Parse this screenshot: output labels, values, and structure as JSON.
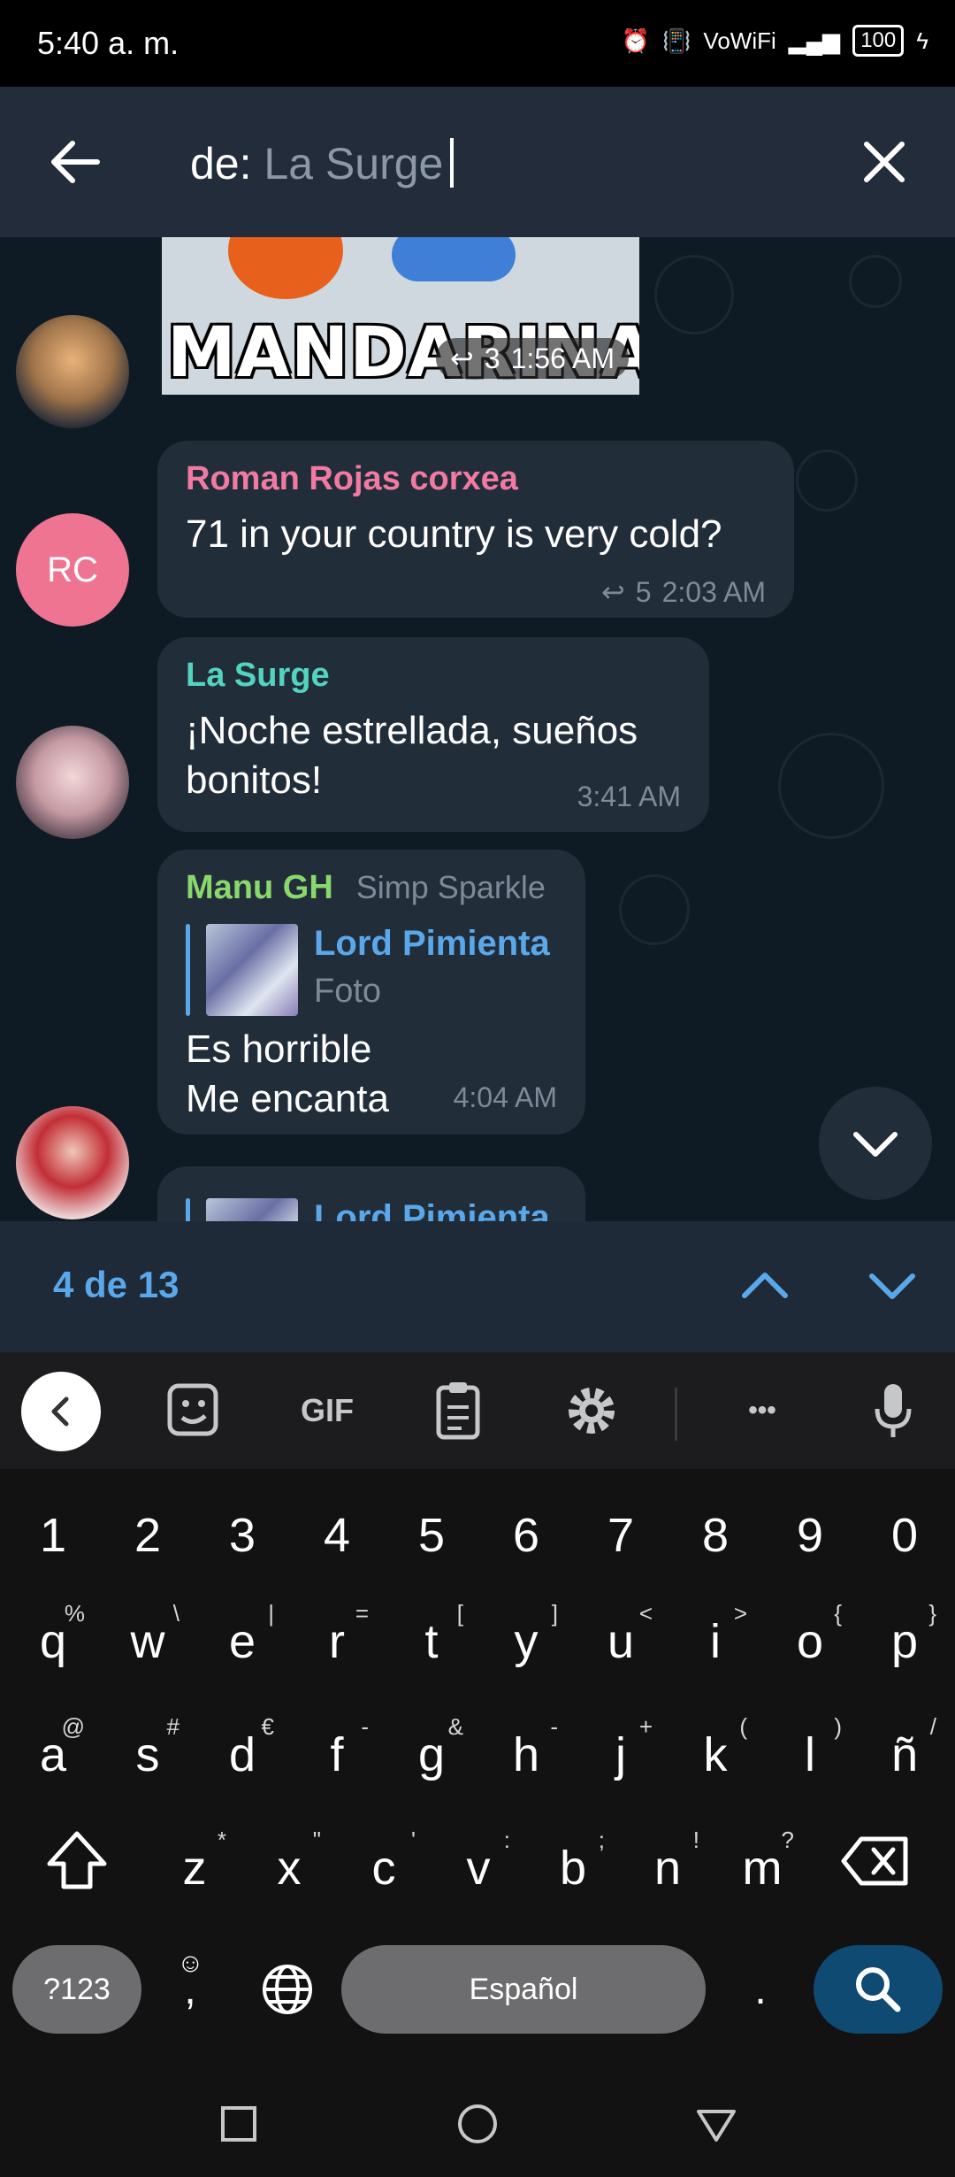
{
  "status_bar": {
    "time": "5:40 a. m.",
    "network_label": "VoWiFi",
    "battery": "100"
  },
  "search": {
    "prefix": "de:",
    "query": "La Surge"
  },
  "messages": [
    {
      "media_caption": "MANDARINA?",
      "replies": "3",
      "time": "1:56 AM"
    },
    {
      "avatar_initials": "RC",
      "sender": "Roman Rojas corxea",
      "text": "71 in your country is very cold?",
      "replies": "5",
      "time": "2:03 AM"
    },
    {
      "sender": "La Surge",
      "text_line1": "¡Noche estrellada, sueños",
      "text_line2": "bonitos!",
      "time": "3:41 AM"
    },
    {
      "sender": "Manu GH",
      "sender_title": "Simp Sparkle",
      "quote_name": "Lord Pimienta",
      "quote_type": "Foto",
      "text_line1": "Es horrible",
      "text_line2": "Me encanta",
      "time": "4:04 AM"
    },
    {
      "quote_name": "Lord Pimienta"
    }
  ],
  "results": {
    "count_label": "4 de 13"
  },
  "keyboard": {
    "toolbar": {
      "gif": "GIF",
      "more": "•••"
    },
    "numbers": [
      "1",
      "2",
      "3",
      "4",
      "5",
      "6",
      "7",
      "8",
      "9",
      "0"
    ],
    "row1": [
      {
        "k": "q",
        "h": "%"
      },
      {
        "k": "w",
        "h": "\\"
      },
      {
        "k": "e",
        "h": "|"
      },
      {
        "k": "r",
        "h": "="
      },
      {
        "k": "t",
        "h": "["
      },
      {
        "k": "y",
        "h": "]"
      },
      {
        "k": "u",
        "h": "<"
      },
      {
        "k": "i",
        "h": ">"
      },
      {
        "k": "o",
        "h": "{"
      },
      {
        "k": "p",
        "h": "}"
      }
    ],
    "row2": [
      {
        "k": "a",
        "h": "@"
      },
      {
        "k": "s",
        "h": "#"
      },
      {
        "k": "d",
        "h": "€"
      },
      {
        "k": "f",
        "h": "-"
      },
      {
        "k": "g",
        "h": "&"
      },
      {
        "k": "h",
        "h": "-"
      },
      {
        "k": "j",
        "h": "+"
      },
      {
        "k": "k",
        "h": "("
      },
      {
        "k": "l",
        "h": ")"
      },
      {
        "k": "ñ",
        "h": "/"
      }
    ],
    "row3": [
      {
        "k": "z",
        "h": "*"
      },
      {
        "k": "x",
        "h": "\""
      },
      {
        "k": "c",
        "h": "'"
      },
      {
        "k": "v",
        "h": ":"
      },
      {
        "k": "b",
        "h": ";"
      },
      {
        "k": "n",
        "h": "!"
      },
      {
        "k": "m",
        "h": "?"
      }
    ],
    "sym_label": "?123",
    "comma": ",",
    "space_label": "Español",
    "period": "."
  },
  "colors": {
    "accent": "#5aa7ea",
    "sender_roman": "#f07aa2",
    "sender_surge": "#53d4c0",
    "sender_manu": "#88d86c",
    "bubble": "#222d3a",
    "chat_bg": "#0f1b24"
  }
}
